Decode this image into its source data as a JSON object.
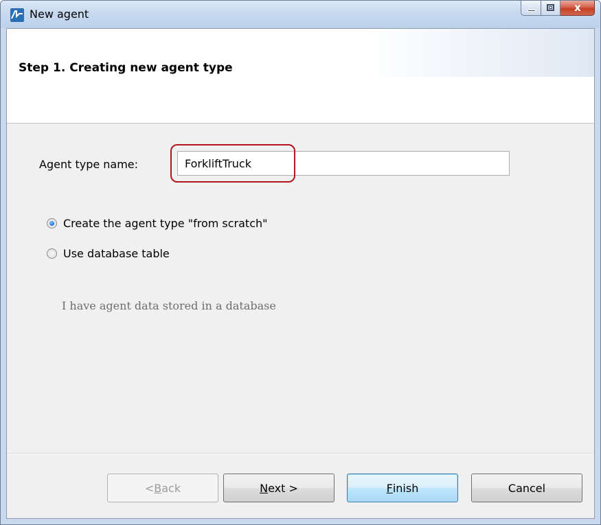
{
  "window": {
    "title": "New agent",
    "close_glyph": "x"
  },
  "header": {
    "step_title": "Step 1. Creating new agent type"
  },
  "form": {
    "name_label": "Agent type name:",
    "name_value": "ForkliftTruck",
    "options": [
      {
        "label": "Create the agent type \"from scratch\"",
        "checked": true
      },
      {
        "label": "Use database table",
        "checked": false
      }
    ],
    "db_hint": "I have agent data stored in a database"
  },
  "buttons": {
    "back_label": "< Back",
    "back_mnemonic": "B",
    "next_label": "Next >",
    "next_mnemonic": "N",
    "finish_label": "Finish",
    "finish_mnemonic": "F",
    "cancel_label": "Cancel"
  },
  "colors": {
    "highlight": "#b4141c",
    "accent": "#3c7fb1"
  }
}
